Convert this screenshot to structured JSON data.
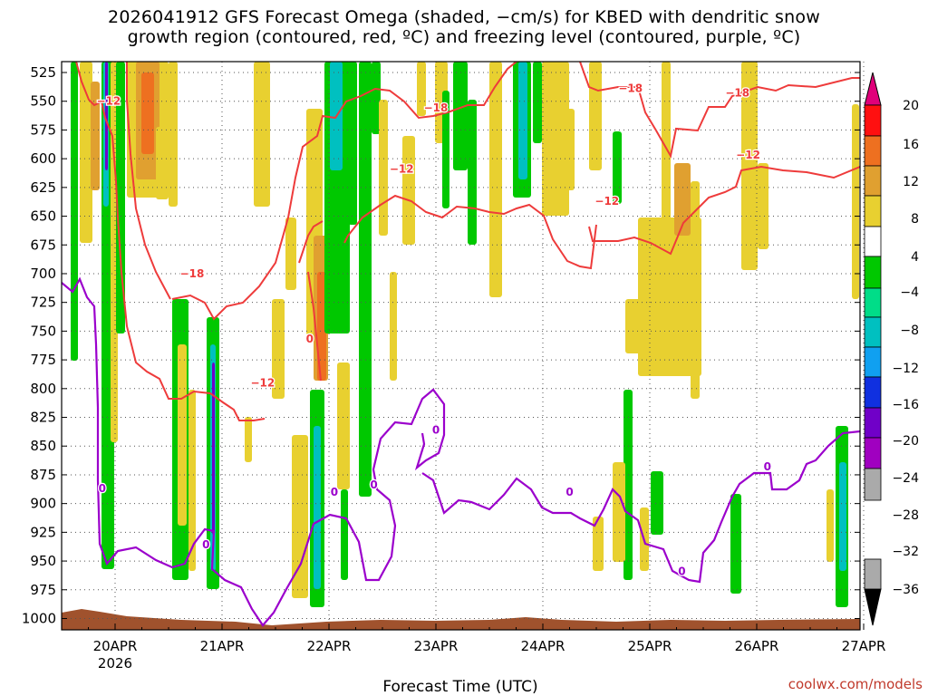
{
  "title_line1": "2026041912 GFS Forecast Omega (shaded, −cm/s) for KBED with dendritic snow",
  "title_line2": "growth region (contoured, red, ºC) and freezing level (contoured, purple, ºC)",
  "xaxis_title": "Forecast Time (UTC)",
  "credit": "coolwx.com/models",
  "year_label": "2026",
  "colors": {
    "temperature_contour": "#ee3b3b",
    "freezing_contour": "#9b00cc",
    "terrain": "#a0522d",
    "grid": "#555555"
  },
  "chart_data": {
    "type": "heatmap",
    "title": "2026041912 GFS Forecast Omega (shaded, −cm/s) for KBED with dendritic snow growth region (contoured, red, ºC) and freezing level (contoured, purple, ºC)",
    "xlabel": "Forecast Time (UTC)",
    "ylabel": "",
    "x_ticks": [
      "20APR",
      "21APR",
      "22APR",
      "23APR",
      "24APR",
      "25APR",
      "26APR",
      "27APR"
    ],
    "x_tick_days": [
      0,
      1,
      2,
      3,
      4,
      5,
      6,
      7
    ],
    "xlim_days": [
      -0.5,
      7
    ],
    "y_ticks": [
      525,
      550,
      575,
      600,
      625,
      650,
      675,
      700,
      725,
      750,
      775,
      800,
      825,
      850,
      875,
      900,
      925,
      950,
      975,
      1000
    ],
    "ylim_hpa": [
      1012,
      518
    ],
    "grid": true,
    "colorbar": {
      "labels": [
        "20",
        "16",
        "12",
        "8",
        "4",
        "−4",
        "−8",
        "−12",
        "−16",
        "−20",
        "−24",
        "−28",
        "−32",
        "−36"
      ],
      "colors": [
        "#ff1010",
        "#ee7020",
        "#e0a030",
        "#e8d030",
        "#ffffff",
        "#00c800",
        "#00dd88",
        "#00c0c0",
        "#10a0f0",
        "#1030e0",
        "#7000c8",
        "#a000c0",
        "#aaaaaa",
        "#000000"
      ],
      "top_arrow_color": "#e0007a",
      "bottom_arrow_color": "#000000",
      "placement": "right"
    },
    "contour_labels": [
      {
        "text": "−12",
        "day": -0.06,
        "p": 553,
        "series": "temperature"
      },
      {
        "text": "−18",
        "day": 0.72,
        "p": 703,
        "series": "temperature"
      },
      {
        "text": "−12",
        "day": 1.38,
        "p": 798,
        "series": "temperature"
      },
      {
        "text": "−12",
        "day": 2.68,
        "p": 612,
        "series": "temperature"
      },
      {
        "text": "−18",
        "day": 3.0,
        "p": 559,
        "series": "temperature"
      },
      {
        "text": "−12",
        "day": 4.6,
        "p": 640,
        "series": "temperature"
      },
      {
        "text": "−18",
        "day": 4.82,
        "p": 542,
        "series": "temperature"
      },
      {
        "text": "−18",
        "day": 5.82,
        "p": 546,
        "series": "temperature"
      },
      {
        "text": "−12",
        "day": 5.92,
        "p": 600,
        "series": "temperature"
      },
      {
        "text": "0",
        "day": 1.82,
        "p": 760,
        "series": "temperature"
      },
      {
        "text": "0",
        "day": -0.12,
        "p": 890,
        "series": "freezing"
      },
      {
        "text": "0",
        "day": 0.85,
        "p": 939,
        "series": "freezing"
      },
      {
        "text": "0",
        "day": 2.05,
        "p": 893,
        "series": "freezing"
      },
      {
        "text": "0",
        "day": 2.42,
        "p": 887,
        "series": "freezing"
      },
      {
        "text": "0",
        "day": 3.0,
        "p": 839,
        "series": "freezing"
      },
      {
        "text": "0",
        "day": 4.25,
        "p": 893,
        "series": "freezing"
      },
      {
        "text": "0",
        "day": 5.3,
        "p": 962,
        "series": "freezing"
      },
      {
        "text": "0",
        "day": 6.1,
        "p": 871,
        "series": "freezing"
      }
    ]
  }
}
